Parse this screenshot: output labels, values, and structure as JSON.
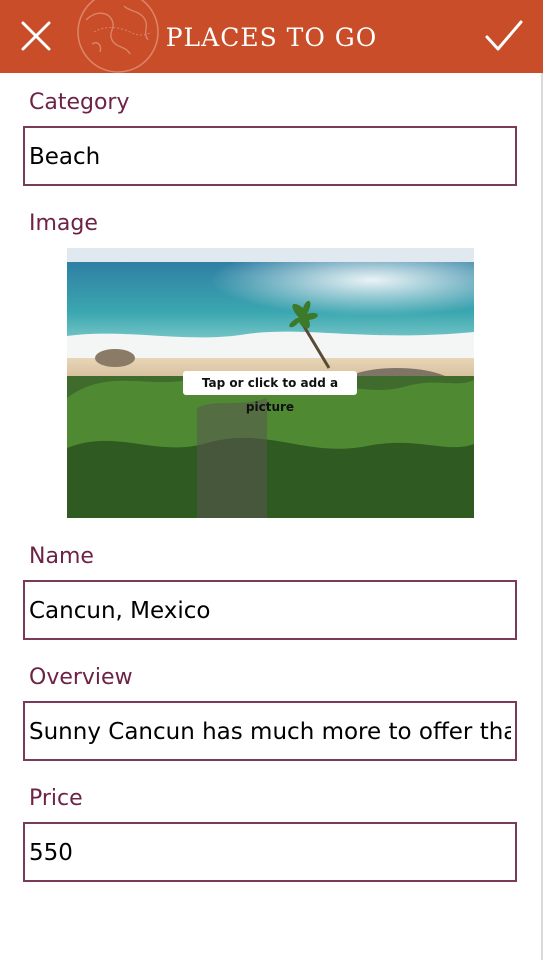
{
  "header": {
    "title": "PLACES TO GO",
    "close_icon": "close-icon",
    "check_icon": "checkmark-icon",
    "logo_icon": "globe-icon",
    "color": "#c84d28"
  },
  "form": {
    "category": {
      "label": "Category",
      "value": "Beach"
    },
    "image": {
      "label": "Image",
      "hint": "Tap or click to add a picture"
    },
    "name": {
      "label": "Name",
      "value": "Cancun, Mexico"
    },
    "overview": {
      "label": "Overview",
      "value": "Sunny Cancun has much more to offer than"
    },
    "price": {
      "label": "Price",
      "value": "550"
    }
  },
  "colors": {
    "label": "#6e2346",
    "border": "#7b3a5c"
  }
}
